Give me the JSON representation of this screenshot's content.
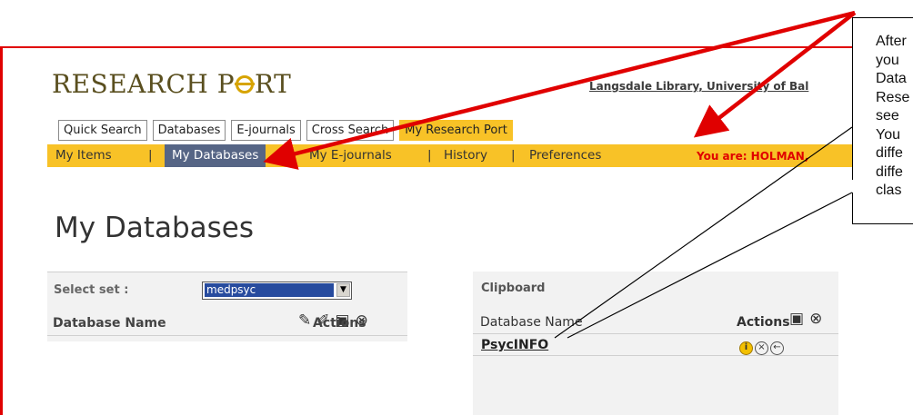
{
  "logo": {
    "part1": "RESEARCH P",
    "part2": "RT"
  },
  "institution_link": "Langsdale Library, University of Bal",
  "tabs": [
    {
      "label": "Quick Search",
      "active": false
    },
    {
      "label": "Databases",
      "active": false
    },
    {
      "label": "E-journals",
      "active": false
    },
    {
      "label": "Cross Search",
      "active": false
    },
    {
      "label": "My Research Port",
      "active": true
    }
  ],
  "subnav": {
    "items": [
      "My Items",
      "My Databases",
      "My E-journals",
      "History",
      "Preferences"
    ],
    "separator": "|",
    "user": "You are: HOLMAN,"
  },
  "page_title": "My Databases",
  "left_panel": {
    "select_label": "Select set :",
    "select_value": "medpsyc",
    "col_name": "Database Name",
    "col_actions": "Actions"
  },
  "right_panel": {
    "title": "Clipboard",
    "col_name": "Database Name",
    "col_actions": "Actions",
    "rows": [
      {
        "name": "PsycINFO"
      }
    ]
  },
  "callout": {
    "lines": [
      "After",
      "you",
      "Data",
      "Rese",
      "see",
      "You",
      "diffe",
      "diffe",
      "clas"
    ]
  },
  "colors": {
    "accent": "#f8c227",
    "annotation": "#e00000",
    "selected_nav": "#566585"
  }
}
